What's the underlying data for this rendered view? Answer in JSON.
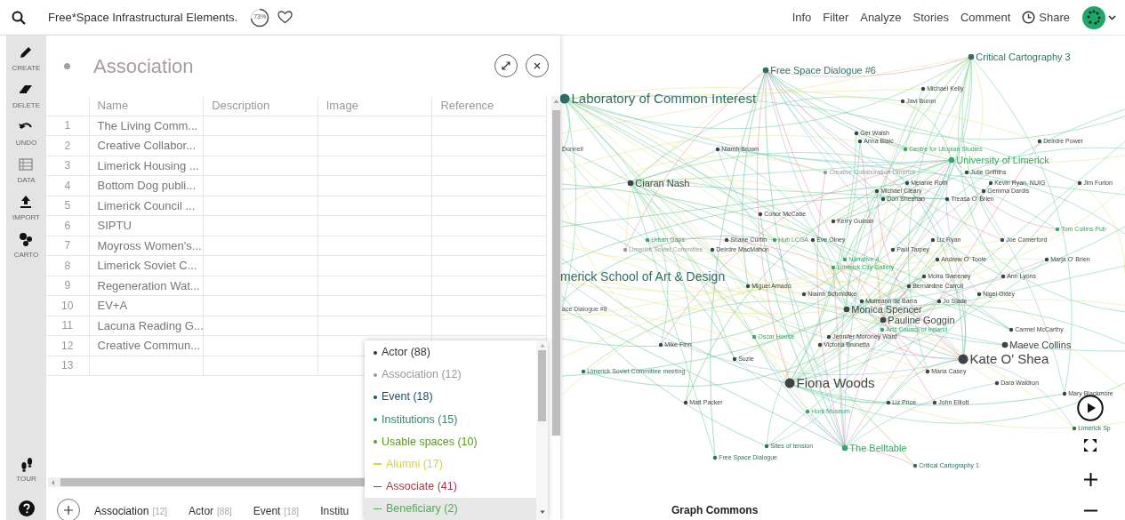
{
  "top_bar": {
    "title": "Free*Space Infrastructural Elements.",
    "progress": {
      "label": "73%"
    },
    "menu": [
      "Info",
      "Filter",
      "Analyze",
      "Stories",
      "Comment"
    ],
    "share": "Share"
  },
  "toolbar": {
    "items": [
      {
        "label": "CREATE"
      },
      {
        "label": "DELETE"
      },
      {
        "label": "UNDO"
      },
      {
        "label": "DATA"
      },
      {
        "label": "IMPORT"
      },
      {
        "label": "CARTO"
      }
    ],
    "tour": "TOUR"
  },
  "panel": {
    "title": "Association",
    "columns": [
      "Name",
      "Description",
      "Image",
      "Reference"
    ],
    "rows": [
      {
        "number": "1",
        "name": "The Living Comm..."
      },
      {
        "number": "2",
        "name": "Creative Collabor..."
      },
      {
        "number": "3",
        "name": "Limerick Housing ..."
      },
      {
        "number": "4",
        "name": "Bottom Dog publi..."
      },
      {
        "number": "5",
        "name": "Limerick Council ..."
      },
      {
        "number": "6",
        "name": "SIPTU"
      },
      {
        "number": "7",
        "name": "Moyross Women's..."
      },
      {
        "number": "8",
        "name": "Limerick Soviet C..."
      },
      {
        "number": "9",
        "name": "Regeneration Wat..."
      },
      {
        "number": "10",
        "name": "EV+A"
      },
      {
        "number": "11",
        "name": "Lacuna Reading G..."
      },
      {
        "number": "12",
        "name": "Creative Commun..."
      },
      {
        "number": "13"
      }
    ]
  },
  "bottom_tabs": [
    {
      "label": "Association",
      "count": "[12]",
      "selected": true
    },
    {
      "label": "Actor",
      "count": "[88]",
      "selected": false
    },
    {
      "label": "Event",
      "count": "[18]",
      "selected": false
    },
    {
      "label": "Institu",
      "selected": false
    }
  ],
  "type_menu": [
    {
      "label": "Actor (88)",
      "kind": "node",
      "color": "#333333",
      "selected": false
    },
    {
      "label": "Association (12)",
      "kind": "node",
      "color": "#999999",
      "selected": false
    },
    {
      "label": "Event (18)",
      "kind": "node",
      "color": "#1d4e6b",
      "selected": false
    },
    {
      "label": "Institutions (15)",
      "kind": "node",
      "color": "#2e8b6a",
      "selected": false
    },
    {
      "label": "Usable spaces (10)",
      "kind": "node",
      "color": "#5a9a1a",
      "selected": false
    },
    {
      "label": "Alumni (17)",
      "kind": "edge",
      "color": "#d7d23a",
      "selected": false
    },
    {
      "label": "Associate (41)",
      "kind": "edge",
      "color": "#a33a4a",
      "selected": false
    },
    {
      "label": "Beneficiary (2)",
      "kind": "edge",
      "color": "#4caf50",
      "selected": true
    }
  ],
  "graph": {
    "footer": "Graph Commons",
    "nodes": [
      {
        "label": "Critical Cartography 3",
        "color": "#2f6f66",
        "kind": "medium"
      },
      {
        "label": "Free Space Dialogue #6",
        "color": "#2f6f66",
        "kind": "medium"
      },
      {
        "label": "Michael Kelly",
        "color": "#3d4347",
        "kind": "small"
      },
      {
        "label": "Laboratory of Common Interest",
        "color": "#2f6f66",
        "kind": "large"
      },
      {
        "label": "Javi Buron",
        "color": "#3d4347",
        "kind": "small"
      },
      {
        "label": "Ger Walsh",
        "color": "#3d4347",
        "kind": "small"
      },
      {
        "label": "Anna Blaic",
        "color": "#3d4347",
        "kind": "small"
      },
      {
        "label": "Deirdre Power",
        "color": "#3d4347",
        "kind": "small"
      },
      {
        "label": "Donnell",
        "kind": "clipped"
      },
      {
        "label": "Niamh Brown",
        "color": "#3d4347",
        "kind": "small"
      },
      {
        "label": "Centre for Utopian Studies",
        "color": "#3aa46a",
        "kind": "small"
      },
      {
        "label": "University of Limerick",
        "color": "#3aa46a",
        "kind": "medium"
      },
      {
        "label": "Creative Collaboration Limerick",
        "color": "#9a9a9a",
        "kind": "small"
      },
      {
        "label": "Julie Griffiths",
        "color": "#3d4347",
        "kind": "small"
      },
      {
        "label": "Ciaran Nash",
        "color": "#3d4347",
        "kind": "medium"
      },
      {
        "label": "Melanie Roth",
        "color": "#3d4347",
        "kind": "small"
      },
      {
        "label": "Kevin Ryan, NUIG",
        "color": "#3d4347",
        "kind": "small"
      },
      {
        "label": "Jim Furlon",
        "color": "#3d4347",
        "kind": "small"
      },
      {
        "label": "Michael Cleary",
        "color": "#3d4347",
        "kind": "small"
      },
      {
        "label": "Gemma Dardis",
        "color": "#3d4347",
        "kind": "small"
      },
      {
        "label": "Don Sheehan",
        "color": "#3d4347",
        "kind": "small"
      },
      {
        "label": "Treasa O' Brien",
        "color": "#3d4347",
        "kind": "small"
      },
      {
        "label": "Conor McCabe",
        "color": "#3d4347",
        "kind": "small"
      },
      {
        "label": "Kerry Guinan",
        "color": "#3d4347",
        "kind": "small"
      },
      {
        "label": "Tom Collins Pub",
        "color": "#3aa46a",
        "kind": "small"
      },
      {
        "label": "Urban Gaps",
        "color": "#3aa46a",
        "kind": "small"
      },
      {
        "label": "Shane Curtin",
        "color": "#3d4347",
        "kind": "small"
      },
      {
        "label": "Hub LCGA",
        "color": "#3aa46a",
        "kind": "small"
      },
      {
        "label": "Eve Olney",
        "color": "#3d4347",
        "kind": "small"
      },
      {
        "label": "Liz Ryan",
        "color": "#3d4347",
        "kind": "small"
      },
      {
        "label": "Joe Comerford",
        "color": "#3d4347",
        "kind": "small"
      },
      {
        "label": "Limerick Soviet Committee",
        "color": "#9a9a9a",
        "kind": "small"
      },
      {
        "label": "Deirdre MacMahon",
        "color": "#3d4347",
        "kind": "small"
      },
      {
        "label": "Paul Tarpey",
        "color": "#3d4347",
        "kind": "small"
      },
      {
        "label": "Narrative 4",
        "color": "#3aa46a",
        "kind": "small"
      },
      {
        "label": "Andrew O' Toole",
        "color": "#3d4347",
        "kind": "small"
      },
      {
        "label": "Marja O' Brien",
        "color": "#3d4347",
        "kind": "small"
      },
      {
        "label": "Limerick City Gallery",
        "color": "#3aa46a",
        "kind": "small"
      },
      {
        "label": "merick School of Art & Design",
        "color": "#2f6f66",
        "kind": "banner"
      },
      {
        "label": "Moira Sweeney",
        "color": "#3d4347",
        "kind": "small"
      },
      {
        "label": "Ann Lyons",
        "color": "#3d4347",
        "kind": "small"
      },
      {
        "label": "Miguel Amado",
        "color": "#3d4347",
        "kind": "small"
      },
      {
        "label": "Bernardine Carroll",
        "color": "#3d4347",
        "kind": "small"
      },
      {
        "label": "Niamh Schmidtke",
        "color": "#3d4347",
        "kind": "small"
      },
      {
        "label": "Nigel Oxley",
        "color": "#3d4347",
        "kind": "small"
      },
      {
        "label": "Muireann de Barra",
        "color": "#3d4347",
        "kind": "small"
      },
      {
        "label": "Jo Slade",
        "color": "#3d4347",
        "kind": "small"
      },
      {
        "label": "ace Dialogue #8",
        "kind": "clipped"
      },
      {
        "label": "Monica Spencer",
        "color": "#3d4347",
        "kind": "medium"
      },
      {
        "label": "Pauline Goggin",
        "color": "#3d4347",
        "kind": "medium"
      },
      {
        "label": "Arts Council of Ireland",
        "color": "#3aa46a",
        "kind": "small"
      },
      {
        "label": "Carmel McCarthy",
        "color": "#3d4347",
        "kind": "small"
      },
      {
        "label": "Oscar House",
        "color": "#3aa46a",
        "kind": "small"
      },
      {
        "label": "Jennifer Moroney Ward",
        "color": "#3d4347",
        "kind": "small"
      },
      {
        "label": "Mike Finn",
        "color": "#3d4347",
        "kind": "small"
      },
      {
        "label": "Victoria Brunetta",
        "color": "#3d4347",
        "kind": "small"
      },
      {
        "label": "Maeve Collins",
        "color": "#3d4347",
        "kind": "medium"
      },
      {
        "label": "Suzie",
        "color": "#3d4347",
        "kind": "small"
      },
      {
        "label": "Kate O' Shea",
        "color": "#3d4347",
        "kind": "large"
      },
      {
        "label": "Limerick Soviet Committee meeting",
        "color": "#2f6f66",
        "kind": "small"
      },
      {
        "label": "Maria Casey",
        "color": "#3d4347",
        "kind": "small"
      },
      {
        "label": "Fiona Woods",
        "color": "#3d4347",
        "kind": "large"
      },
      {
        "label": "Dara Waldron",
        "color": "#3d4347",
        "kind": "small"
      },
      {
        "label": "Mary Blackmore",
        "color": "#3d4347",
        "kind": "small"
      },
      {
        "label": "Matt Packer",
        "color": "#3d4347",
        "kind": "small"
      },
      {
        "label": "Liz Price",
        "color": "#3d4347",
        "kind": "small"
      },
      {
        "label": "John Elliott",
        "color": "#3d4347",
        "kind": "small"
      },
      {
        "label": "Hunt Museum",
        "color": "#3aa46a",
        "kind": "small"
      },
      {
        "label": "Limerick Sp",
        "color": "#2f6f66",
        "kind": "small"
      },
      {
        "label": "Sites of tension",
        "color": "#2f6f66",
        "kind": "small"
      },
      {
        "label": "The Belltable",
        "color": "#3aa46a",
        "kind": "medium"
      },
      {
        "label": "Free Space Dialogue",
        "color": "#2f6f66",
        "kind": "small"
      },
      {
        "label": "Critical Cartography 1",
        "color": "#2f6f66",
        "kind": "small"
      }
    ]
  }
}
